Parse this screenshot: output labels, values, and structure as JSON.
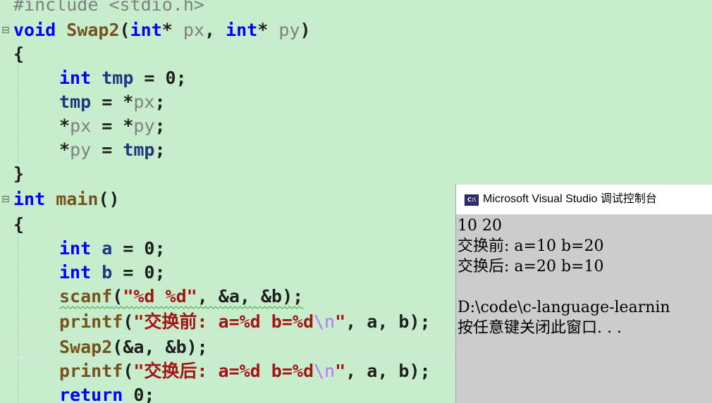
{
  "editor": {
    "include_line": "#include <stdio.h>",
    "swap_sig": {
      "kw_void": "void",
      "name": "Swap2",
      "open": "(",
      "kw_int1": "int",
      "star1": "*",
      "p1": "px",
      "comma": ",",
      "kw_int2": "int",
      "star2": "*",
      "p2": "py",
      "close": ")"
    },
    "brace_open": "{",
    "brace_close": "}",
    "swap_body": [
      {
        "kw": "int",
        "var": "tmp",
        "rest": " = 0;"
      },
      {
        "lhs": "tmp",
        "mid": " = *",
        "rhs": "px",
        "end": ";"
      },
      {
        "pre": "*",
        "lhs": "px",
        "mid": " = *",
        "rhs": "py",
        "end": ";"
      },
      {
        "pre": "*",
        "lhs": "py",
        "mid": " = ",
        "rhs": "tmp",
        "end": ";"
      }
    ],
    "main_sig": {
      "kw_int": "int",
      "name": "main",
      "parens": "()"
    },
    "main_body": {
      "decl_a": {
        "kw": "int",
        "var": "a",
        "rest": " = 0;"
      },
      "decl_b": {
        "kw": "int",
        "var": "b",
        "rest": " = 0;"
      },
      "scanf": {
        "fn": "scanf",
        "open": "(",
        "str": "\"%d %d\"",
        "args": ", &a, &b);"
      },
      "printf1": {
        "fn": "printf",
        "open": "(",
        "str1": "\"交换前: a=%d b=%d",
        "esc": "\\n",
        "str2": "\"",
        "args": ", a, b);"
      },
      "swapcall": {
        "fn": "Swap2",
        "args": "(&a, &b);"
      },
      "printf2": {
        "fn": "printf",
        "open": "(",
        "str1": "\"交换后: a=%d b=%d",
        "esc": "\\n",
        "str2": "\"",
        "args": ", a, b);"
      },
      "ret": {
        "kw": "return",
        "rest": " 0;"
      }
    },
    "fold_glyph": "⊟"
  },
  "console": {
    "title": "Microsoft Visual Studio 调试控制台",
    "icon_text": "C:\\",
    "lines": [
      "10 20",
      "交换前: a=10 b=20",
      "交换后: a=20 b=10",
      "",
      "D:\\code\\c-language-learnin",
      "按任意键关闭此窗口. . ."
    ]
  },
  "colors": {
    "editor_bg": "#c7edcc",
    "keyword": "#0000ff",
    "function": "#74531f",
    "string": "#a31515",
    "console_bg": "#cccccc"
  }
}
